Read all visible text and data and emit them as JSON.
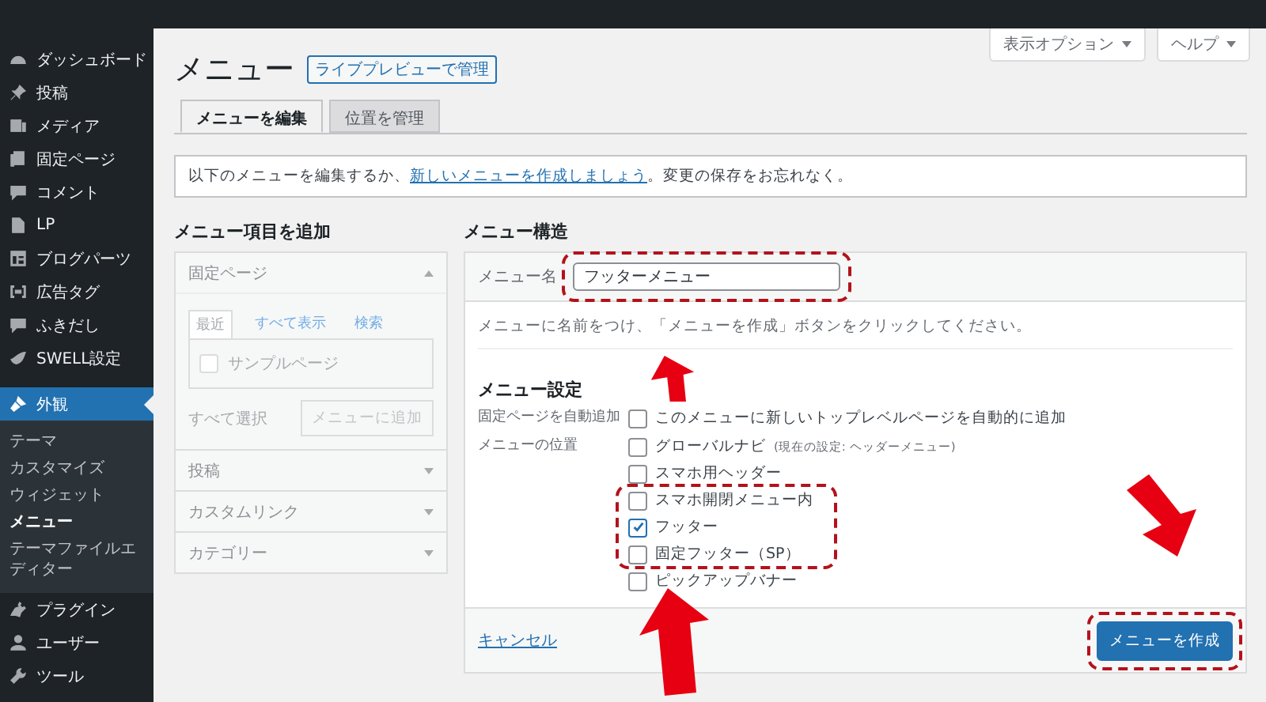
{
  "sidebar": {
    "items": [
      {
        "label": "ダッシュボード",
        "selected": false
      },
      {
        "label": "投稿",
        "selected": false
      },
      {
        "label": "メディア",
        "selected": false
      },
      {
        "label": "固定ページ",
        "selected": false
      },
      {
        "label": "コメント",
        "selected": false
      },
      {
        "label": "LP",
        "selected": false
      },
      {
        "label": "ブログパーツ",
        "selected": false
      },
      {
        "label": "広告タグ",
        "selected": false
      },
      {
        "label": "ふきだし",
        "selected": false
      },
      {
        "label": "SWELL設定",
        "selected": false
      },
      {
        "label": "外観",
        "selected": true,
        "children": [
          {
            "label": "テーマ",
            "selected": false
          },
          {
            "label": "カスタマイズ",
            "selected": false
          },
          {
            "label": "ウィジェット",
            "selected": false
          },
          {
            "label": "メニュー",
            "selected": true
          },
          {
            "label": "テーマファイルエディター",
            "selected": false
          }
        ]
      },
      {
        "label": "プラグイン",
        "selected": false
      },
      {
        "label": "ユーザー",
        "selected": false
      },
      {
        "label": "ツール",
        "selected": false
      }
    ]
  },
  "top_buttons": [
    {
      "label": "表示オプション"
    },
    {
      "label": "ヘルプ"
    }
  ],
  "page": {
    "title": "メニュー",
    "live_preview_button": "ライブプレビューで管理"
  },
  "tabs": [
    {
      "label": "メニューを編集",
      "selected": true
    },
    {
      "label": "位置を管理",
      "selected": false
    }
  ],
  "notice": {
    "before": "以下のメニューを編集するか、",
    "link": "新しいメニューを作成しましょう",
    "after": "。変更の保存をお忘れなく。"
  },
  "add_items": {
    "heading": "メニュー項目を追加",
    "sections": [
      {
        "title": "固定ページ",
        "expanded": true,
        "tabs": [
          {
            "label": "最近",
            "selected": true
          },
          {
            "label": "すべて表示",
            "selected": false
          },
          {
            "label": "検索",
            "selected": false
          }
        ],
        "items": [
          {
            "label": "サンプルページ",
            "checked": false
          }
        ],
        "select_all": "すべて選択",
        "add_button": "メニューに追加"
      },
      {
        "title": "投稿",
        "expanded": false
      },
      {
        "title": "カスタムリンク",
        "expanded": false
      },
      {
        "title": "カテゴリー",
        "expanded": false
      }
    ]
  },
  "structure": {
    "heading": "メニュー構造",
    "name_label": "メニュー名",
    "name_value": "フッターメニュー",
    "hint": "メニューに名前をつけ、「メニューを作成」ボタンをクリックしてください。",
    "settings_heading": "メニュー設定",
    "settings": [
      {
        "label": "固定ページを自動追加",
        "options": [
          {
            "label": "このメニューに新しいトップレベルページを自動的に追加",
            "checked": false
          }
        ]
      },
      {
        "label": "メニューの位置",
        "options": [
          {
            "label": "グローバルナビ",
            "note": "(現在の設定: ヘッダーメニュー)",
            "checked": false
          },
          {
            "label": "スマホ用ヘッダー",
            "checked": false
          },
          {
            "label": "スマホ開閉メニュー内",
            "checked": false
          },
          {
            "label": "フッター",
            "checked": true
          },
          {
            "label": "固定フッター（SP）",
            "checked": false
          },
          {
            "label": "ピックアップバナー",
            "checked": false
          }
        ]
      }
    ],
    "cancel": "キャンセル",
    "create_button": "メニューを作成"
  }
}
